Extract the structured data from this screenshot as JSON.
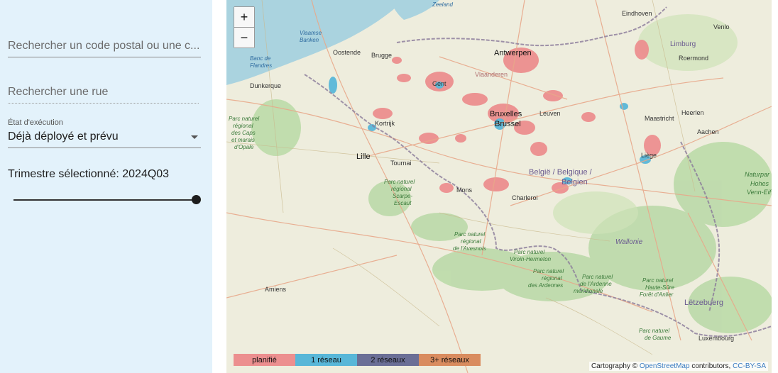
{
  "sidebar": {
    "postal_search": {
      "placeholder": "Rechercher un code postal ou une c..."
    },
    "street_search": {
      "placeholder": "Rechercher une rue"
    },
    "execution_state": {
      "label": "État d'exécution",
      "value": "Déjà déployé et prévu"
    },
    "quarter": {
      "label": "Trimestre sélectionné: 2024Q03",
      "slider_position": 1.0
    }
  },
  "map": {
    "zoom_in": "+",
    "zoom_out": "−",
    "legend": [
      {
        "label": "planifié",
        "color": "#ec8f8f"
      },
      {
        "label": "1 réseau",
        "color": "#58b7d8"
      },
      {
        "label": "2 réseaux",
        "color": "#6b6f96"
      },
      {
        "label": "3+ réseaux",
        "color": "#d98c5f"
      }
    ],
    "attribution": {
      "prefix": "Cartography ©",
      "link1": "OpenStreetMap",
      "middle": "contributors,",
      "link2": "CC-BY-SA"
    },
    "labels": {
      "zeeland": "Zeeland",
      "eindhoven": "Eindhoven",
      "venlo": "Venlo",
      "limburg": "Limburg",
      "roermond": "Roermond",
      "vlaamse_banken_1": "Vlaamse",
      "vlaamse_banken_2": "Banken",
      "oostende": "Oostende",
      "brugge": "Brugge",
      "antwerpen": "Antwerpen",
      "banc_1": "Banc de",
      "banc_2": "Flandres",
      "vlaanderen": "Vlaanderen",
      "dunkerque": "Dunkerque",
      "gent": "Gent",
      "bruxelles": "Bruxelles",
      "brussel": "Brussel",
      "leuven": "Leuven",
      "maastricht": "Maastricht",
      "heerlen": "Heerlen",
      "aachen": "Aachen",
      "kortrijk": "Kortrijk",
      "pn_caps_1": "Parc naturel",
      "pn_caps_2": "régional",
      "pn_caps_3": "des Caps",
      "pn_caps_4": "et marais",
      "pn_caps_5": "d'Opale",
      "lille": "Lille",
      "tournai": "Tournai",
      "liege": "Liège",
      "belgie": "België / Belgique /",
      "belgien": "Belgien",
      "pn_scarpe_1": "Parc naturel",
      "pn_scarpe_2": "régional",
      "pn_scarpe_3": "Scarpe-",
      "pn_scarpe_4": "Escaut",
      "mons": "Mons",
      "charleroi": "Charleroi",
      "naturpark_1": "Naturpar",
      "naturpark_2": "Hohes",
      "naturpark_3": "Venn-Eif",
      "pn_avesnois_1": "Parc naturel",
      "pn_avesnois_2": "régional",
      "pn_avesnois_3": "de l'Avesnois",
      "wallonie": "Wallonie",
      "pn_viroin_1": "Parc naturel",
      "pn_viroin_2": "Viroin-Hermeton",
      "pn_ardennes_1": "Parc naturel",
      "pn_ardennes_2": "régional",
      "pn_ardennes_3": "des Ardennes",
      "pn_ardenne_m_1": "Parc naturel",
      "pn_ardenne_m_2": "de l'Ardenne",
      "pn_ardenne_m_3": "méridionale",
      "pn_hs_1": "Parc naturel",
      "pn_hs_2": "Haute-Sûre",
      "pn_hs_3": "Forêt d'Anlier",
      "amiens": "Amiens",
      "letzebuerg": "Lëtzebuerg",
      "pn_gaume_1": "Parc naturel",
      "pn_gaume_2": "de Gaume",
      "luxembourg": "Luxembourg"
    }
  }
}
